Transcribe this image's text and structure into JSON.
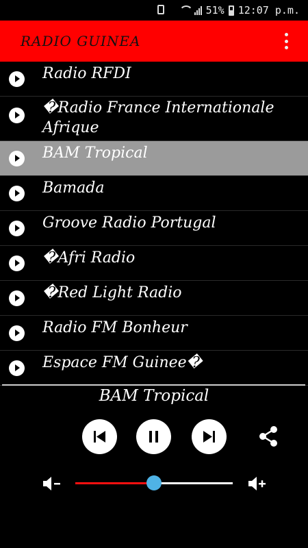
{
  "status_bar": {
    "battery": "51%",
    "time": "12:07 p.m."
  },
  "app_bar": {
    "title": "RADIO GUINEA"
  },
  "stations": [
    {
      "name": "Radio RFDI"
    },
    {
      "name": "�Radio France Internationale Afrique"
    },
    {
      "name": "BAM Tropical",
      "selected": true
    },
    {
      "name": "Bamada"
    },
    {
      "name": "Groove Radio Portugal"
    },
    {
      "name": "�Afri Radio"
    },
    {
      "name": "�Red Light Radio"
    },
    {
      "name": "Radio FM Bonheur"
    },
    {
      "name": "Espace FM Guinee�"
    }
  ],
  "player": {
    "now_playing": "BAM Tropical",
    "volume_level": 0.5,
    "colors": {
      "volume_fill": "#ff1010",
      "volume_thumb": "#4fb3e6",
      "app_bar": "#ff0000",
      "selected_row": "#9b9b9b"
    }
  },
  "icons": {
    "play": "play-icon",
    "prev": "skip-previous-icon",
    "pause": "pause-icon",
    "next": "skip-next-icon",
    "share": "share-icon",
    "volume_down": "volume-down-icon",
    "volume_up": "volume-up-icon",
    "overflow": "more-vert-icon"
  }
}
